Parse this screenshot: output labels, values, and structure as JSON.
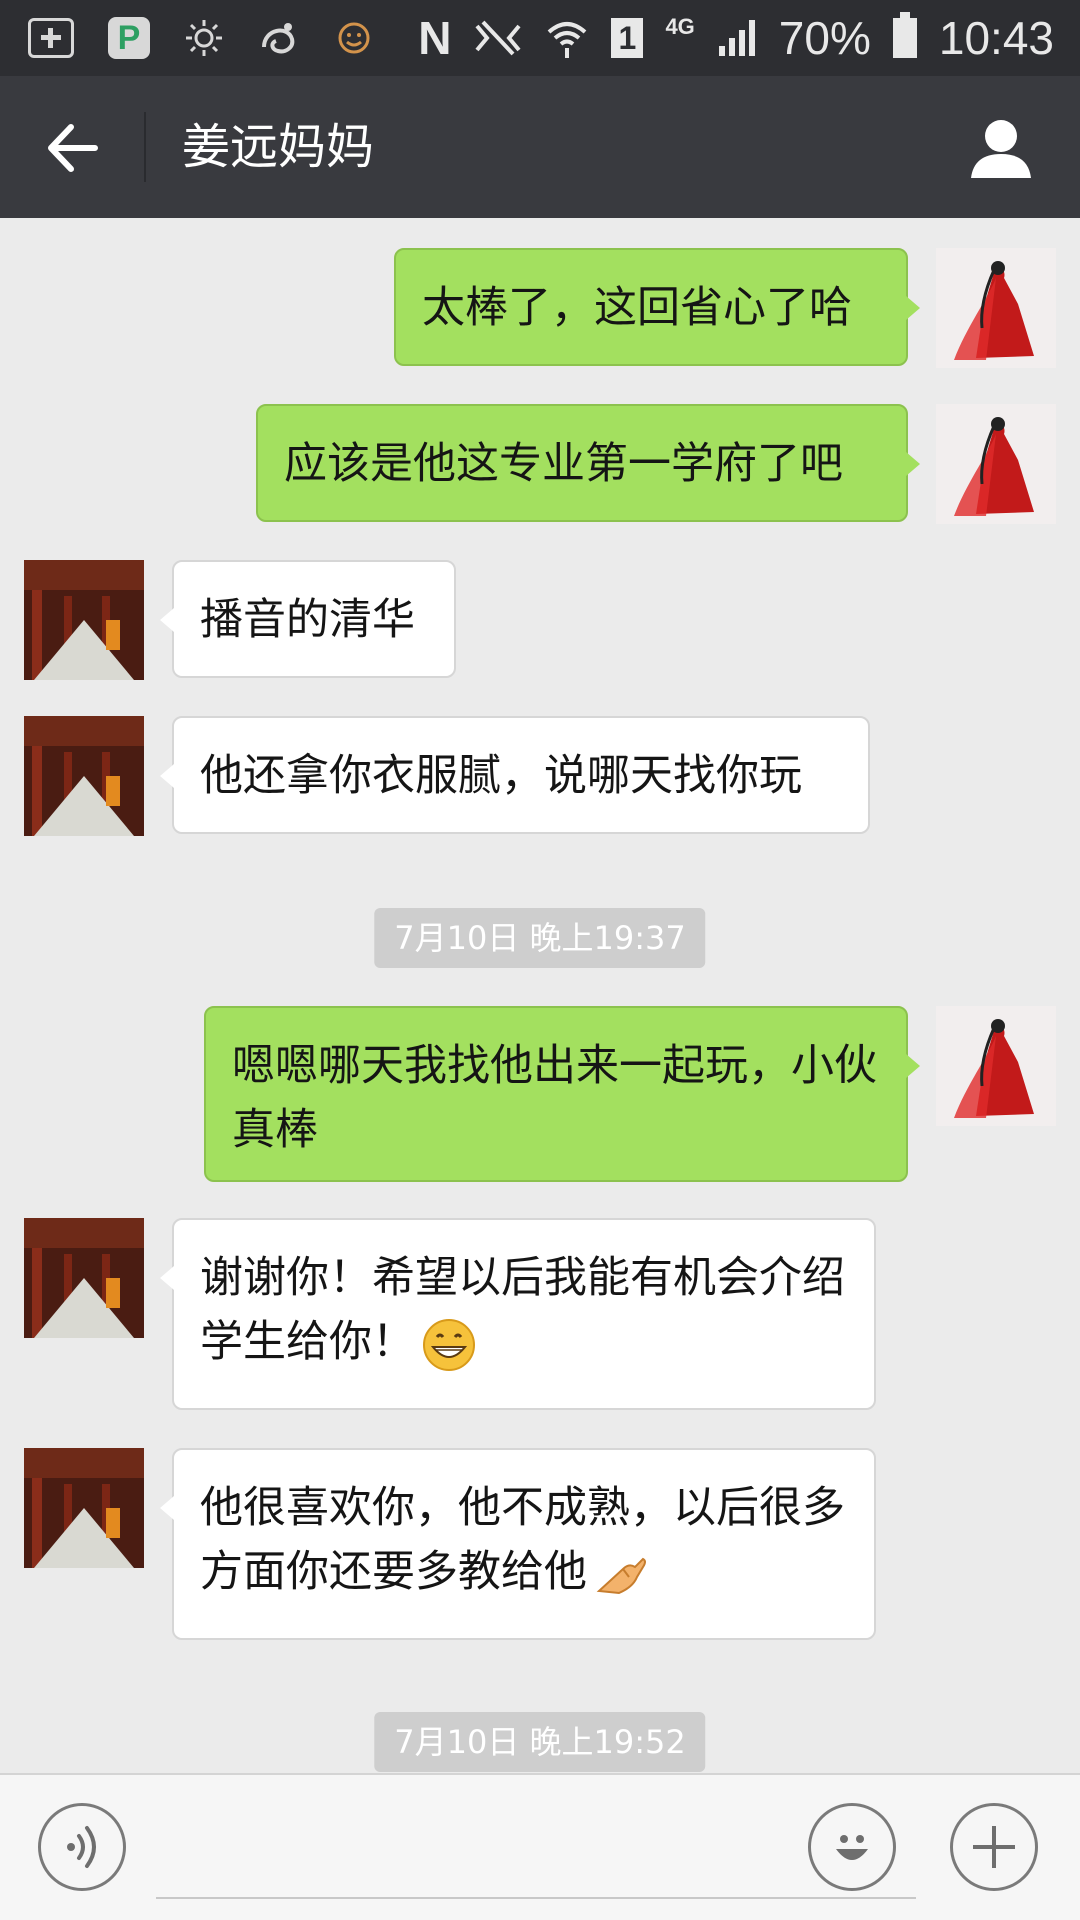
{
  "status_bar": {
    "battery": "70%",
    "time": "10:43",
    "network": "4G",
    "sim_slot": "1",
    "icons": [
      "add-box-icon",
      "p-app-icon",
      "brightness-icon",
      "uc-browser-icon",
      "smiley-notification-icon",
      "nfc-icon",
      "mute-icon",
      "wifi-icon",
      "sim-icon",
      "signal-icon",
      "battery-icon"
    ]
  },
  "header": {
    "title": "姜远妈妈",
    "back_icon": "arrow-left-icon",
    "profile_icon": "person-icon"
  },
  "messages": [
    {
      "side": "me",
      "text": "太棒了，这回省心了哈"
    },
    {
      "side": "me",
      "text": "应该是他这专业第一学府了吧"
    },
    {
      "side": "other",
      "text": "播音的清华"
    },
    {
      "side": "other",
      "text": "他还拿你衣服腻，说哪天找你玩"
    },
    {
      "type": "time",
      "text": "7月10日 晚上19:37"
    },
    {
      "side": "me",
      "text": "嗯嗯哪天我找他出来一起玩，小伙真棒"
    },
    {
      "side": "other",
      "text": "谢谢你！希望以后我能有机会介绍学生给你！",
      "emoji": "grinning-face-icon"
    },
    {
      "side": "other",
      "text": "他很喜欢你，他不成熟，以后很多方面你还要多教给他",
      "emoji": "pinching-hand-icon"
    },
    {
      "type": "time",
      "text": "7月10日 晚上19:52"
    }
  ],
  "input_bar": {
    "value": "",
    "placeholder": "",
    "icons": [
      "voice-icon",
      "emoji-icon",
      "plus-icon"
    ]
  },
  "colors": {
    "status_bar": "#2d2e32",
    "header": "#393a3f",
    "chat_bg": "#ebebeb",
    "bubble_me": "#a3e05f",
    "bubble_other": "#ffffff"
  }
}
